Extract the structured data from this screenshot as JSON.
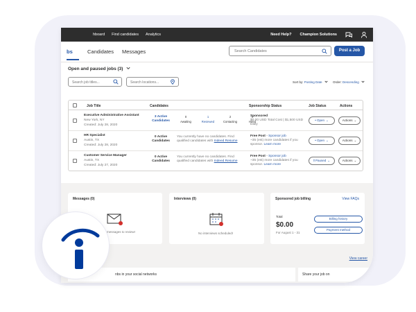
{
  "topbar": {
    "nav": [
      "hboard",
      "Find candidates",
      "Analytics"
    ],
    "help": "Need Help?",
    "company": "Champion Solutions"
  },
  "header": {
    "tabs": [
      "bs",
      "Candidates",
      "Messages"
    ],
    "search_placeholder": "Search Candidates",
    "post_job": "Post a Job"
  },
  "filters": {
    "title": "Open and paused jobs (3)",
    "search_jobs_placeholder": "Search job titles...",
    "search_locations_placeholder": "Search locations...",
    "sort_label": "Sort by:",
    "sort_value": "Posting Date",
    "order_label": "Order:",
    "order_value": "Descending"
  },
  "table": {
    "headers": {
      "title": "Job Title",
      "candidates": "Candidates",
      "sponsorship": "Sponsorship Status",
      "status": "Job Status",
      "actions": "Actions"
    },
    "rows": [
      {
        "title": "Executive Administrative Assistant",
        "location": "New York, NY",
        "created": "Created: July 28, 2020",
        "candidates": "3 Active Candidates",
        "stats": [
          {
            "value": "0",
            "label": "Awaiting"
          },
          {
            "value": "1",
            "label": "Reviewed"
          },
          {
            "value": "2",
            "label": "Contacting"
          },
          {
            "value": "0",
            "label": "Hired"
          }
        ],
        "sponsorship_title": "Sponsored",
        "sponsorship_detail": "$0.00 USD Total Cost | $1,500 USD Daily",
        "status": "Open",
        "actions": "Actions"
      },
      {
        "title": "HR Specialist",
        "location": "Austin, TX",
        "created": "Created: July 28, 2020",
        "candidates": "0 Active Candidates",
        "no_candidates": "You currently have no candidates. Find qualified candidates with",
        "resume_link": "Indeed Resume",
        "sponsorship_title": "Free Post",
        "sponsor_link": "Sponsor job",
        "sponsorship_detail": "~35 (est) more candidates if you sponsor.",
        "learn_more": "Learn more",
        "status": "Open",
        "actions": "Actions"
      },
      {
        "title": "Customer Service Manager",
        "location": "Austin, TX",
        "created": "Created: July 27, 2020",
        "candidates": "0 Active Candidates",
        "no_candidates": "You currently have no candidates. Find qualified candidates with",
        "resume_link": "Indeed Resume",
        "sponsorship_title": "Free Post",
        "sponsor_link": "Sponsor job",
        "sponsorship_detail": "~35 (est) more candidates if you sponsor.",
        "learn_more": "Learn more",
        "status": "Paused",
        "actions": "Actions"
      }
    ]
  },
  "panels": {
    "messages": {
      "title": "Messages (0)",
      "empty": "messages to review!"
    },
    "interviews": {
      "title": "Interviews (0)",
      "empty": "No interviews scheduled!"
    },
    "billing": {
      "title": "Sponsored job billing",
      "faq": "View FAQs",
      "total_label": "Total",
      "total_value": "$0.00",
      "period": "For August 1 - 31",
      "history": "Billing history",
      "payment": "Payment method"
    },
    "careers_link": "View career",
    "social_text": "nbs in your social networks",
    "share_text": "Share your job on"
  },
  "colors": {
    "brand": "#2557a7",
    "topbar": "#2d2d2d",
    "logo": "#003a9b"
  }
}
